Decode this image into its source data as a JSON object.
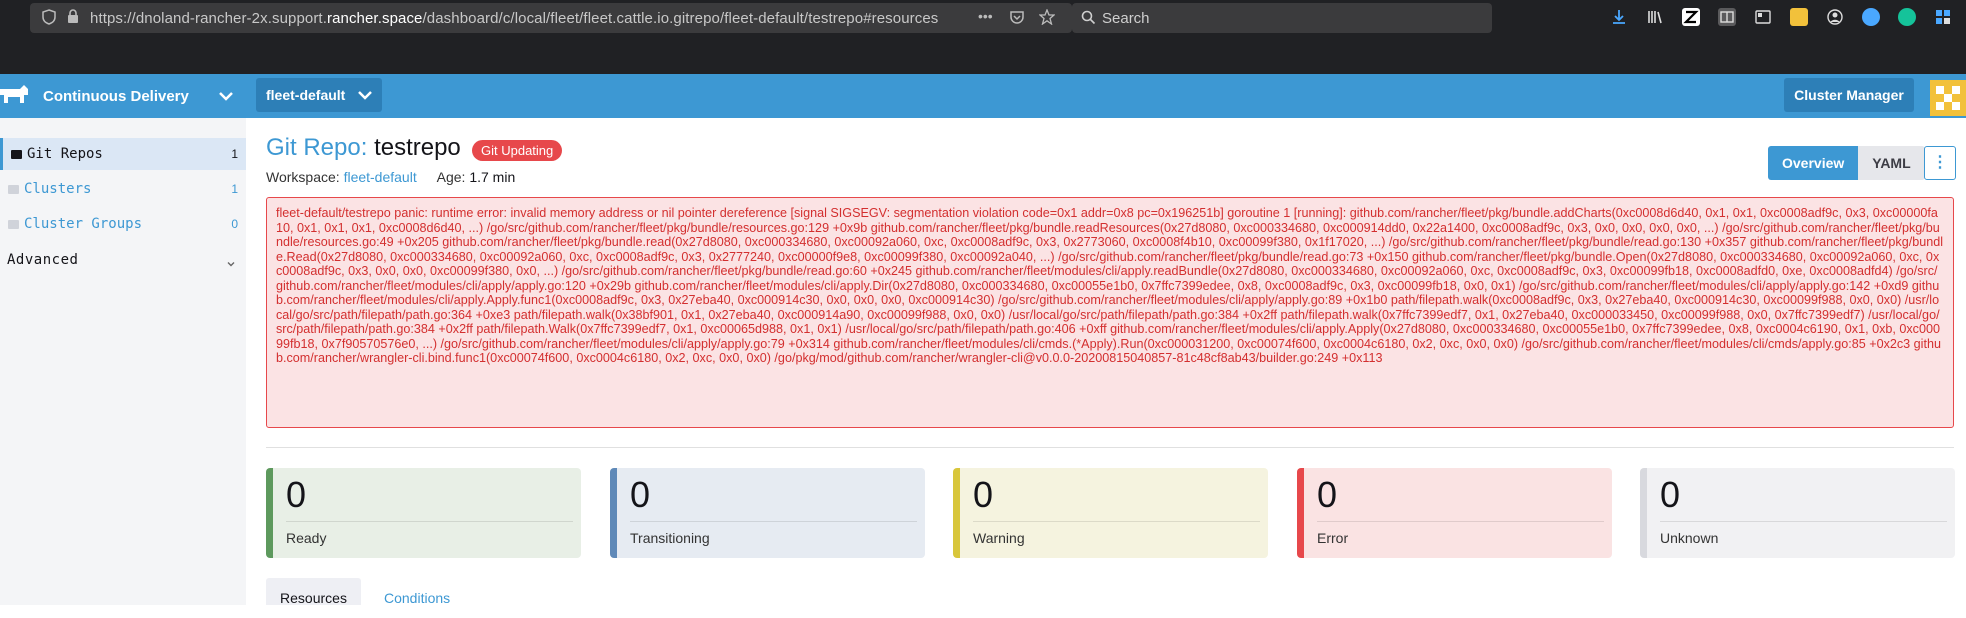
{
  "browser": {
    "url_prefix": "https://dnoland-rancher-2x.support.",
    "url_domain": "rancher.space",
    "url_path": "/dashboard/c/local/fleet/fleet.cattle.io.gitrepo/fleet-default/testrepo#resources",
    "search_placeholder": "Search",
    "more": "•••"
  },
  "header": {
    "product": "Continuous Delivery",
    "workspace": "fleet-default",
    "cluster_manager": "Cluster Manager"
  },
  "sidebar": {
    "items": [
      {
        "label": "Git Repos",
        "count": "1",
        "active": true
      },
      {
        "label": "Clusters",
        "count": "1"
      },
      {
        "label": "Cluster Groups",
        "count": "0"
      }
    ],
    "advanced": "Advanced"
  },
  "page": {
    "kind": "Git Repo:",
    "name": "testrepo",
    "badge": "Git Updating",
    "workspace_label": "Workspace:",
    "workspace_value": "fleet-default",
    "age_label": "Age:",
    "age_value": "1.7 min"
  },
  "view_tabs": {
    "overview": "Overview",
    "yaml": "YAML",
    "more": "⋮"
  },
  "error_message": "fleet-default/testrepo panic: runtime error: invalid memory address or nil pointer dereference [signal SIGSEGV: segmentation violation code=0x1 addr=0x8 pc=0x196251b] goroutine 1 [running]: github.com/rancher/fleet/pkg/bundle.addCharts(0xc0008d6d40, 0x1, 0x1, 0xc0008adf9c, 0x3, 0xc00000fa10, 0x1, 0x1, 0x1, 0xc0008d6d40, ...) /go/src/github.com/rancher/fleet/pkg/bundle/resources.go:129 +0x9b github.com/rancher/fleet/pkg/bundle.readResources(0x27d8080, 0xc000334680, 0xc000914dd0, 0x22a1400, 0xc0008adf9c, 0x3, 0x0, 0x0, 0x0, 0x0, ...) /go/src/github.com/rancher/fleet/pkg/bundle/resources.go:49 +0x205 github.com/rancher/fleet/pkg/bundle.read(0x27d8080, 0xc000334680, 0xc00092a060, 0xc, 0xc0008adf9c, 0x3, 0x2773060, 0xc0008f4b10, 0xc00099f380, 0x1f17020, ...) /go/src/github.com/rancher/fleet/pkg/bundle/read.go:130 +0x357 github.com/rancher/fleet/pkg/bundle.Read(0x27d8080, 0xc000334680, 0xc00092a060, 0xc, 0xc0008adf9c, 0x3, 0x2777240, 0xc00000f9e8, 0xc00099f380, 0xc00092a040, ...) /go/src/github.com/rancher/fleet/pkg/bundle/read.go:73 +0x150 github.com/rancher/fleet/pkg/bundle.Open(0x27d8080, 0xc000334680, 0xc00092a060, 0xc, 0xc0008adf9c, 0x3, 0x0, 0x0, 0xc00099f380, 0x0, ...) /go/src/github.com/rancher/fleet/pkg/bundle/read.go:60 +0x245 github.com/rancher/fleet/modules/cli/apply.readBundle(0x27d8080, 0xc000334680, 0xc00092a060, 0xc, 0xc0008adf9c, 0x3, 0xc00099fb18, 0xc0008adfd0, 0xe, 0xc0008adfd4) /go/src/github.com/rancher/fleet/modules/cli/apply/apply.go:120 +0x29b github.com/rancher/fleet/modules/cli/apply.Dir(0x27d8080, 0xc000334680, 0xc00055e1b0, 0x7ffc7399edee, 0x8, 0xc0008adf9c, 0x3, 0xc00099fb18, 0x0, 0x1) /go/src/github.com/rancher/fleet/modules/cli/apply/apply.go:142 +0xd9 github.com/rancher/fleet/modules/cli/apply.Apply.func1(0xc0008adf9c, 0x3, 0x27eba40, 0xc000914c30, 0x0, 0x0, 0x0, 0xc000914c30) /go/src/github.com/rancher/fleet/modules/cli/apply/apply.go:89 +0x1b0 path/filepath.walk(0xc0008adf9c, 0x3, 0x27eba40, 0xc000914c30, 0xc00099f988, 0x0, 0x0) /usr/local/go/src/path/filepath/path.go:364 +0xe3 path/filepath.walk(0x38bf901, 0x1, 0x27eba40, 0xc000914a90, 0xc00099f988, 0x0, 0x0) /usr/local/go/src/path/filepath/path.go:384 +0x2ff path/filepath.walk(0x7ffc7399edf7, 0x1, 0x27eba40, 0xc000033450, 0xc00099f988, 0x0, 0x7ffc7399edf7) /usr/local/go/src/path/filepath/path.go:384 +0x2ff path/filepath.Walk(0x7ffc7399edf7, 0x1, 0xc00065d988, 0x1, 0x1) /usr/local/go/src/path/filepath/path.go:406 +0xff github.com/rancher/fleet/modules/cli/apply.Apply(0x27d8080, 0xc000334680, 0xc00055e1b0, 0x7ffc7399edee, 0x8, 0xc0004c6190, 0x1, 0xb, 0xc00099fb18, 0x7f90570576e0, ...) /go/src/github.com/rancher/fleet/modules/cli/apply/apply.go:79 +0x314 github.com/rancher/fleet/modules/cli/cmds.(*Apply).Run(0xc000031200, 0xc00074f600, 0xc0004c6180, 0x2, 0xc, 0x0, 0x0) /go/src/github.com/rancher/fleet/modules/cli/cmds/apply.go:85 +0x2c3 github.com/rancher/wrangler-cli.bind.func1(0xc00074f600, 0xc0004c6180, 0x2, 0xc, 0x0, 0x0) /go/pkg/mod/github.com/rancher/wrangler-cli@v0.0.0-20200815040857-81c48cf8ab43/builder.go:249 +0x113",
  "status_cards": [
    {
      "value": "0",
      "label": "Ready",
      "accent": "#5d995d",
      "bg": "#e8efe6"
    },
    {
      "value": "0",
      "label": "Transitioning",
      "accent": "#5f89b8",
      "bg": "#e6ebf2"
    },
    {
      "value": "0",
      "label": "Warning",
      "accent": "#d8c63b",
      "bg": "#f5f3df"
    },
    {
      "value": "0",
      "label": "Error",
      "accent": "#e7484b",
      "bg": "#fae3e3"
    },
    {
      "value": "0",
      "label": "Unknown",
      "accent": "#d8d9de",
      "bg": "#f1f1f3"
    }
  ],
  "tabs": {
    "resources": "Resources",
    "conditions": "Conditions"
  },
  "colors": {
    "header": "#3d98d3",
    "sidebar_bg": "#f4f5f7",
    "error": "#e7484b"
  }
}
